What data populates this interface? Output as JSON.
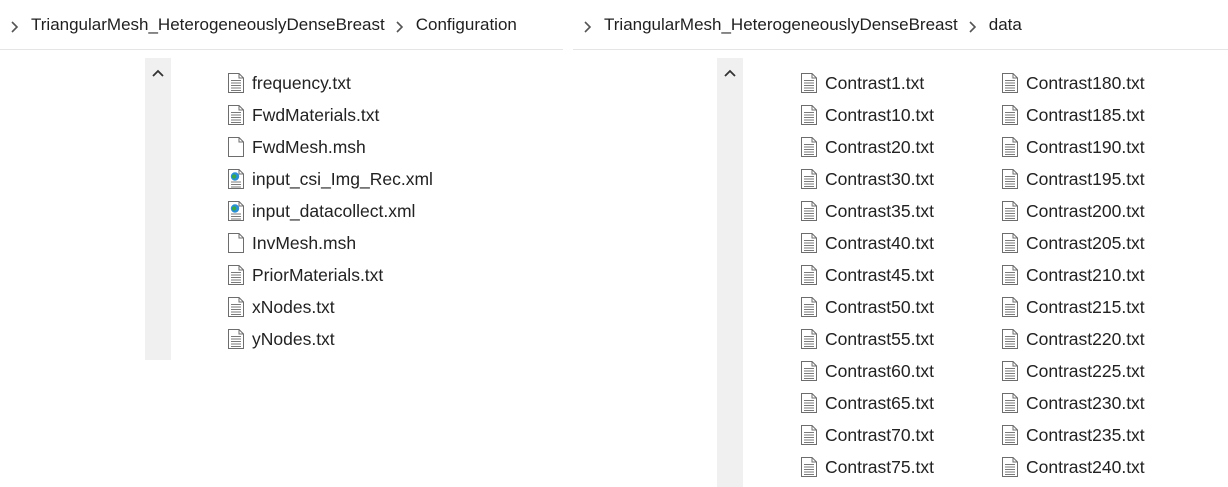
{
  "left_pane": {
    "breadcrumb": [
      "TriangularMesh_HeterogeneouslyDenseBreast",
      "Configuration"
    ],
    "files": [
      {
        "name": "frequency.txt",
        "icon": "text-file-icon"
      },
      {
        "name": "FwdMaterials.txt",
        "icon": "text-file-icon"
      },
      {
        "name": "FwdMesh.msh",
        "icon": "blank-file-icon"
      },
      {
        "name": "input_csi_Img_Rec.xml",
        "icon": "xml-file-icon"
      },
      {
        "name": "input_datacollect.xml",
        "icon": "xml-file-icon"
      },
      {
        "name": "InvMesh.msh",
        "icon": "blank-file-icon"
      },
      {
        "name": "PriorMaterials.txt",
        "icon": "text-file-icon"
      },
      {
        "name": "xNodes.txt",
        "icon": "text-file-icon"
      },
      {
        "name": "yNodes.txt",
        "icon": "text-file-icon"
      }
    ]
  },
  "right_pane": {
    "breadcrumb": [
      "TriangularMesh_HeterogeneouslyDenseBreast",
      "data"
    ],
    "column1": [
      "Contrast1.txt",
      "Contrast10.txt",
      "Contrast20.txt",
      "Contrast30.txt",
      "Contrast35.txt",
      "Contrast40.txt",
      "Contrast45.txt",
      "Contrast50.txt",
      "Contrast55.txt",
      "Contrast60.txt",
      "Contrast65.txt",
      "Contrast70.txt",
      "Contrast75.txt"
    ],
    "column2": [
      "Contrast180.txt",
      "Contrast185.txt",
      "Contrast190.txt",
      "Contrast195.txt",
      "Contrast200.txt",
      "Contrast205.txt",
      "Contrast210.txt",
      "Contrast215.txt",
      "Contrast220.txt",
      "Contrast225.txt",
      "Contrast230.txt",
      "Contrast235.txt",
      "Contrast240.txt"
    ],
    "file_icon": "text-file-icon"
  },
  "icons": {
    "chevron": "chevron-right-icon",
    "scroll_up": "chevron-up-icon"
  },
  "colors": {
    "scrollbar_track": "#f0f0f0",
    "divider": "#e5e5e5",
    "xml_globe": "#2a8fd6",
    "xml_leaf": "#3aa84a"
  }
}
